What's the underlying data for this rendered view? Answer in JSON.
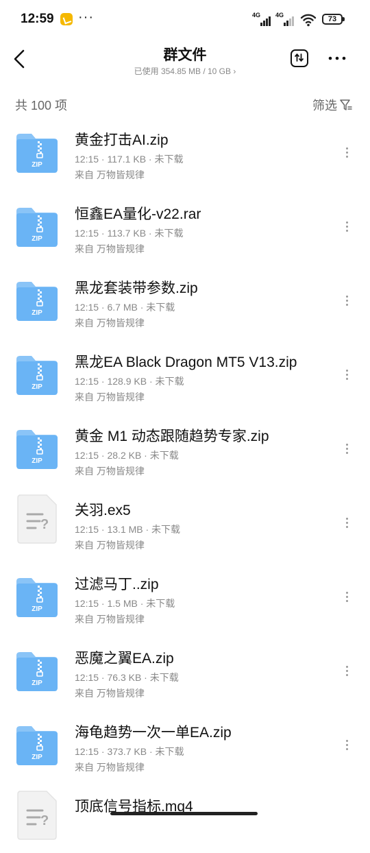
{
  "status_bar": {
    "time": "12:59",
    "more": "···",
    "signal1_label": "4G",
    "signal2_label": "4G",
    "battery": "73"
  },
  "header": {
    "title": "群文件",
    "storage": "已使用 354.85 MB / 10 GB ›"
  },
  "toolbar": {
    "count": "共 100 项",
    "filter_label": "筛选"
  },
  "files": [
    {
      "name": "黄金打击AI.zip",
      "meta": "12:15 · 117.1 KB · 未下载",
      "source": "来自 万物皆规律",
      "type": "zip"
    },
    {
      "name": "恒鑫EA量化-v22.rar",
      "meta": "12:15 · 113.7 KB · 未下载",
      "source": "来自 万物皆规律",
      "type": "zip"
    },
    {
      "name": "黑龙套装带参数.zip",
      "meta": "12:15 · 6.7 MB · 未下载",
      "source": "来自 万物皆规律",
      "type": "zip"
    },
    {
      "name": "黑龙EA Black Dragon MT5 V13.zip",
      "meta": "12:15 · 128.9 KB · 未下载",
      "source": "来自 万物皆规律",
      "type": "zip"
    },
    {
      "name": "黄金 M1 动态跟随趋势专家.zip",
      "meta": "12:15 · 28.2 KB · 未下载",
      "source": "来自 万物皆规律",
      "type": "zip"
    },
    {
      "name": "关羽.ex5",
      "meta": "12:15 · 13.1 MB · 未下载",
      "source": "来自 万物皆规律",
      "type": "unknown"
    },
    {
      "name": "过滤马丁..zip",
      "meta": "12:15 · 1.5 MB · 未下载",
      "source": "来自 万物皆规律",
      "type": "zip"
    },
    {
      "name": "恶魔之翼EA.zip",
      "meta": "12:15 · 76.3 KB · 未下载",
      "source": "来自 万物皆规律",
      "type": "zip"
    },
    {
      "name": "海龟趋势一次一单EA.zip",
      "meta": "12:15 · 373.7 KB · 未下载",
      "source": "来自 万物皆规律",
      "type": "zip"
    },
    {
      "name": "顶底信号指标.mq4",
      "meta": "",
      "source": "",
      "type": "unknown"
    }
  ],
  "icons": {
    "zip_label": "ZIP",
    "unknown_label": "?"
  },
  "colors": {
    "zip_folder": "#6ab4f5",
    "zip_folder_tab": "#8ac4f7",
    "unknown_file": "#f2f2f2"
  }
}
